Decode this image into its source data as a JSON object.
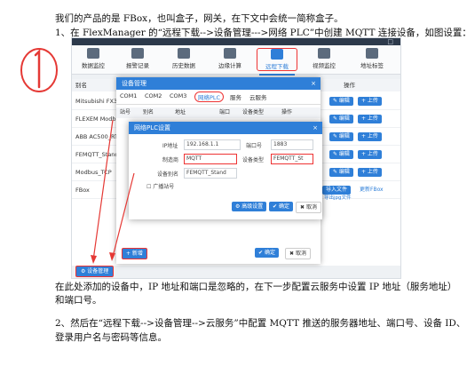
{
  "doc": {
    "p1": "我们的产品的是 FBox，也叫盒子，网关，在下文中会统一简称盒子。",
    "p2": "1、在 FlexManager 的“远程下载-->设备管理--->网络 PLC”中创建 MQTT 连接设备，如图设置：",
    "p3": "在此处添加的设备中，IP 地址和端口是忽略的，在下一步配置云服务中设置 IP 地址（服务地址）",
    "p4": "和端口号。",
    "p5": "2、然后在“远程下载-->设备管理-->云服务”中配置 MQTT 推送的服务器地址、端口号、设备 ID、",
    "p6": "登录用户名与密码等信息。"
  },
  "app": {
    "window_controls": "□",
    "toolbar": [
      "数据监控",
      "报警记录",
      "历史数据",
      "边缘计算",
      "远程下载",
      "视频监控",
      "地址标签"
    ],
    "active_tool": "远程下载",
    "table_header": {
      "name": "别名",
      "op": "操作"
    },
    "rows": [
      "Mitsubishi FX3U",
      "FLEXEM Modbus",
      "ABB AC500_RTU",
      "FEMQTT_Standar",
      "Modbus_TCP",
      "FBox"
    ],
    "row_buttons": {
      "edit": "✎ 编辑",
      "upload": "+ 上传"
    },
    "import": "导入文件",
    "update": "更新FBox",
    "import_sub": "导出jpg文件",
    "device_manage_btn": "设备管理"
  },
  "dialog1": {
    "title": "设备管理",
    "close": "×",
    "tabs": [
      "COM1",
      "COM2",
      "COM3",
      "网络PLC",
      "服务",
      "云服务"
    ],
    "active_tab": "网络PLC",
    "cols": [
      "站号",
      "别名",
      "地址",
      "端口",
      "设备类型",
      "操作"
    ],
    "add_btn": "+ 新增",
    "ok": "确定",
    "cancel": "取消"
  },
  "dialog2": {
    "title": "网络PLC设置",
    "close": "×",
    "ip_label": "IP地址",
    "ip_value": "192.168.1.1",
    "port_label": "端口号",
    "port_value": "1883",
    "maker_label": "制造商",
    "maker_value": "MQTT",
    "type_label": "设备类型",
    "type_value": "FEMQTT_St",
    "alias_label": "设备别名",
    "alias_value": "FEMQTT_Stand",
    "broadcast_label": "广播站号",
    "adv_btn": "高级设置",
    "ok_btn": "确定",
    "cancel_btn": "取消"
  },
  "annotation": {
    "mark": "1",
    "color": "#e53935"
  }
}
